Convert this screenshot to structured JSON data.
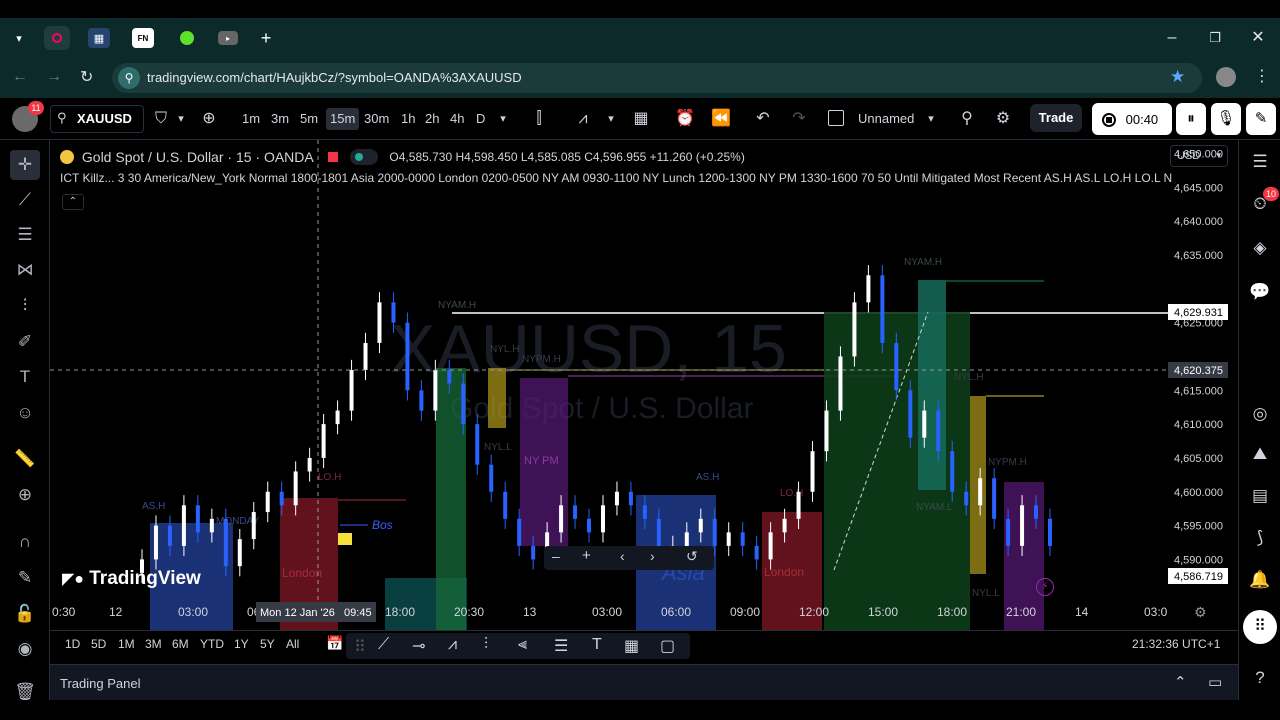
{
  "browser": {
    "url": "tradingview.com/chart/HAujkbCz/?symbol=OANDA%3AXAUUSD",
    "tabs": [
      "rec-tab",
      "tv-tab",
      "fn-tab",
      "green-tab",
      "media-tab"
    ],
    "fn_label": "FN"
  },
  "toolbar": {
    "notif_count": "11",
    "symbol": "XAUUSD",
    "timeframes": [
      "1m",
      "3m",
      "5m",
      "15m",
      "30m",
      "1h",
      "2h",
      "4h",
      "D"
    ],
    "active_timeframe": "15m",
    "layout_name": "Unnamed",
    "trade_label": "Trade",
    "timer": "00:40"
  },
  "legend": {
    "title": "Gold Spot / U.S. Dollar · 15 · OANDA",
    "ohlc": "O4,585.730 H4,598.450 L4,585.085 C4,596.955 +11.260 (+0.25%)",
    "indicator": "ICT Killz... 3 30 America/New_York Normal 1800-1801 Asia 2000-0000 London 0200-0500 NY AM 0930-1100 NY Lunch 1200-1300 NY PM 1330-1600 70 50 Until Mitigated Most Recent AS.H AS.L LO.H LO.L N"
  },
  "currency": "USD",
  "watermark": {
    "symbol": "XAUUSD, 15",
    "desc": "Gold Spot / U.S. Dollar",
    "logo": "TradingView"
  },
  "price_axis": [
    "4,650.000",
    "4,645.000",
    "4,640.000",
    "4,635.000",
    "4,625.000",
    "4,615.000",
    "4,610.000",
    "4,605.000",
    "4,600.000",
    "4,595.000",
    "4,590.000"
  ],
  "price_tags": {
    "last": "4,629.931",
    "cross": "4,620.375",
    "bottom": "4,586.719"
  },
  "time_axis": [
    "0:30",
    "12",
    "03:00",
    "06:00",
    "15:00",
    "18:00",
    "20:30",
    "13",
    "03:00",
    "06:00",
    "09:00",
    "12:00",
    "15:00",
    "18:00",
    "21:00",
    "14",
    "03:0"
  ],
  "cross_time": "Mon 12 Jan '26   09:45",
  "session_labels": {
    "asia_h": "AS.H",
    "monday": "MONDAY",
    "lo_h": "LO.H",
    "bos": "Bos",
    "london": "London",
    "nyam_h": "NYAM.H",
    "nyl_h": "NYL.H",
    "nypm_h": "NYPM.H",
    "nyl_l": "NYL.L",
    "nypm": "NY PM",
    "as_h2": "AS.H",
    "asia": "Asia",
    "lo_h2": "LO.H",
    "london2": "London",
    "nyam_h2": "NYAM.H",
    "nyl_h2": "NYL.H",
    "nypm_h2": "NYPM.H",
    "nyam_l": "NYAM.L",
    "nyl_l2": "NYL.L"
  },
  "ranges": [
    "1D",
    "5D",
    "1M",
    "3M",
    "6M",
    "YTD",
    "1Y",
    "5Y",
    "All"
  ],
  "clock": "21:32:36 UTC+1",
  "trading_panel": "Trading Panel",
  "alert_count": "10",
  "chart_data": {
    "type": "candlestick",
    "title": "Gold Spot / U.S. Dollar · 15 · OANDA",
    "ylim": [
      4584,
      4652
    ],
    "closes": [
      4590,
      4595,
      4592,
      4598,
      4594,
      4596,
      4589,
      4593,
      4597,
      4600,
      4598,
      4603,
      4605,
      4610,
      4612,
      4618,
      4622,
      4628,
      4625,
      4615,
      4612,
      4618,
      4616,
      4610,
      4604,
      4600,
      4596,
      4592,
      4590,
      4594,
      4598,
      4596,
      4594,
      4598,
      4600,
      4598,
      4596,
      4590,
      4592,
      4594,
      4596,
      4592,
      4594,
      4592,
      4590,
      4594,
      4596,
      4600,
      4606,
      4612,
      4620,
      4628,
      4632,
      4622,
      4615,
      4608,
      4612,
      4606,
      4600,
      4598,
      4602,
      4596,
      4592,
      4598,
      4596,
      4592
    ]
  }
}
